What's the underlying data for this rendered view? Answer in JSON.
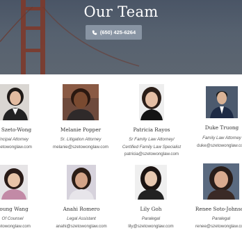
{
  "hero": {
    "title": "Our Team",
    "phone": "(650) 425-6264"
  },
  "row1": [
    {
      "name": "u Szeto-Wong",
      "title": "incipal Attorney",
      "email": "szetowonglaw.com"
    },
    {
      "name": "Melanie Popper",
      "title": "Sr. Litigation Attorney",
      "email": "melanie@szetowonglaw.com"
    },
    {
      "name": "Patricia Rayos",
      "title": "Sr Family Law Attorney/",
      "title2": "Certified Family Law Specialist",
      "email": "patricia@szetowonglaw.com"
    },
    {
      "name": "Duke Truong",
      "title": "Family Law Attorney",
      "email": "duke@szetowonglaw.com"
    }
  ],
  "row2": [
    {
      "name": "young Wang",
      "title": "Of Counsel",
      "email": "szetowonglaw.com"
    },
    {
      "name": "Anahi Romero",
      "title": "Legal Assistant",
      "email": "anahi@szetowonglaw.com"
    },
    {
      "name": "Lily Goh",
      "title": "Paralegal",
      "email": "lily@szetowonglaw.com"
    },
    {
      "name": "Renee Soto-Johnson",
      "title": "Paralegal",
      "email": "renee@szetowonglaw.com"
    }
  ],
  "colors": {
    "hero_bg": "#56616f",
    "button_bg": "#8894a3",
    "bridge": "#7a3b2e"
  }
}
